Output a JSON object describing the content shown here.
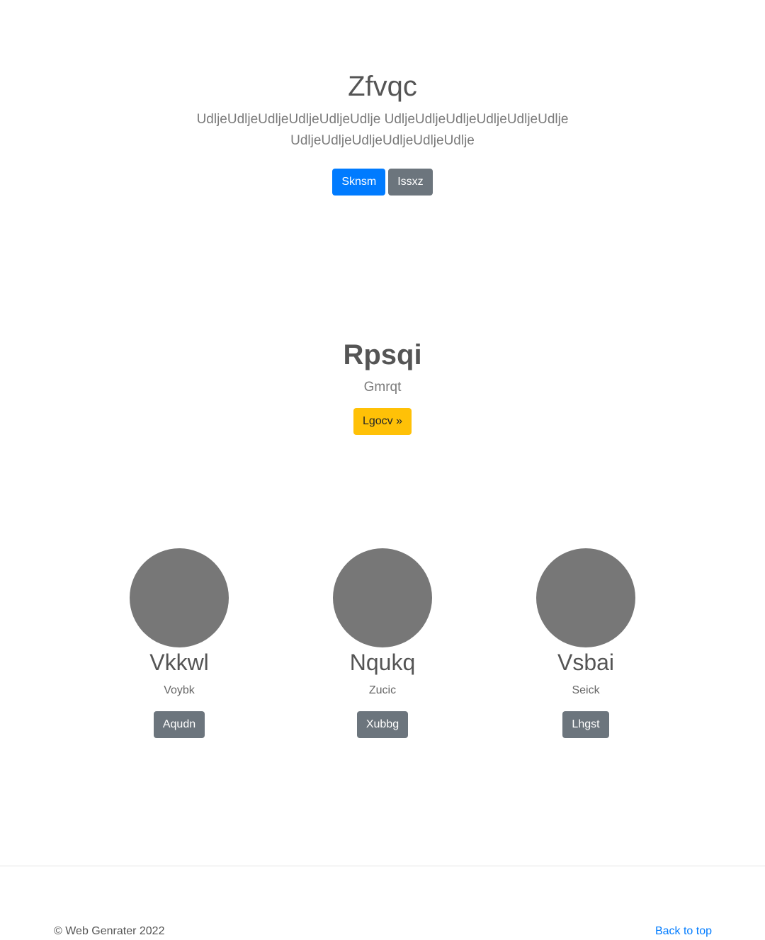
{
  "hero": {
    "title": "Zfvqc",
    "lead": "UdljeUdljeUdljeUdljeUdljeUdlje UdljeUdljeUdljeUdljeUdljeUdlje UdljeUdljeUdljeUdljeUdljeUdlje",
    "primary_button": "Sknsm",
    "secondary_button": "Issxz"
  },
  "feature": {
    "title": "Rpsqi",
    "subtitle": "Gmrqt",
    "button": "Lgocv »"
  },
  "cards": [
    {
      "title": "Vkkwl",
      "subtitle": "Voybk",
      "button": "Aqudn"
    },
    {
      "title": "Nqukq",
      "subtitle": "Zucic",
      "button": "Xubbg"
    },
    {
      "title": "Vsbai",
      "subtitle": "Seick",
      "button": "Lhgst"
    }
  ],
  "footer": {
    "copyright": "© Web Genrater 2022",
    "back_to_top": "Back to top"
  },
  "colors": {
    "primary": "#007bff",
    "secondary": "#6c757d",
    "warning": "#ffc107",
    "avatar": "#777777"
  }
}
